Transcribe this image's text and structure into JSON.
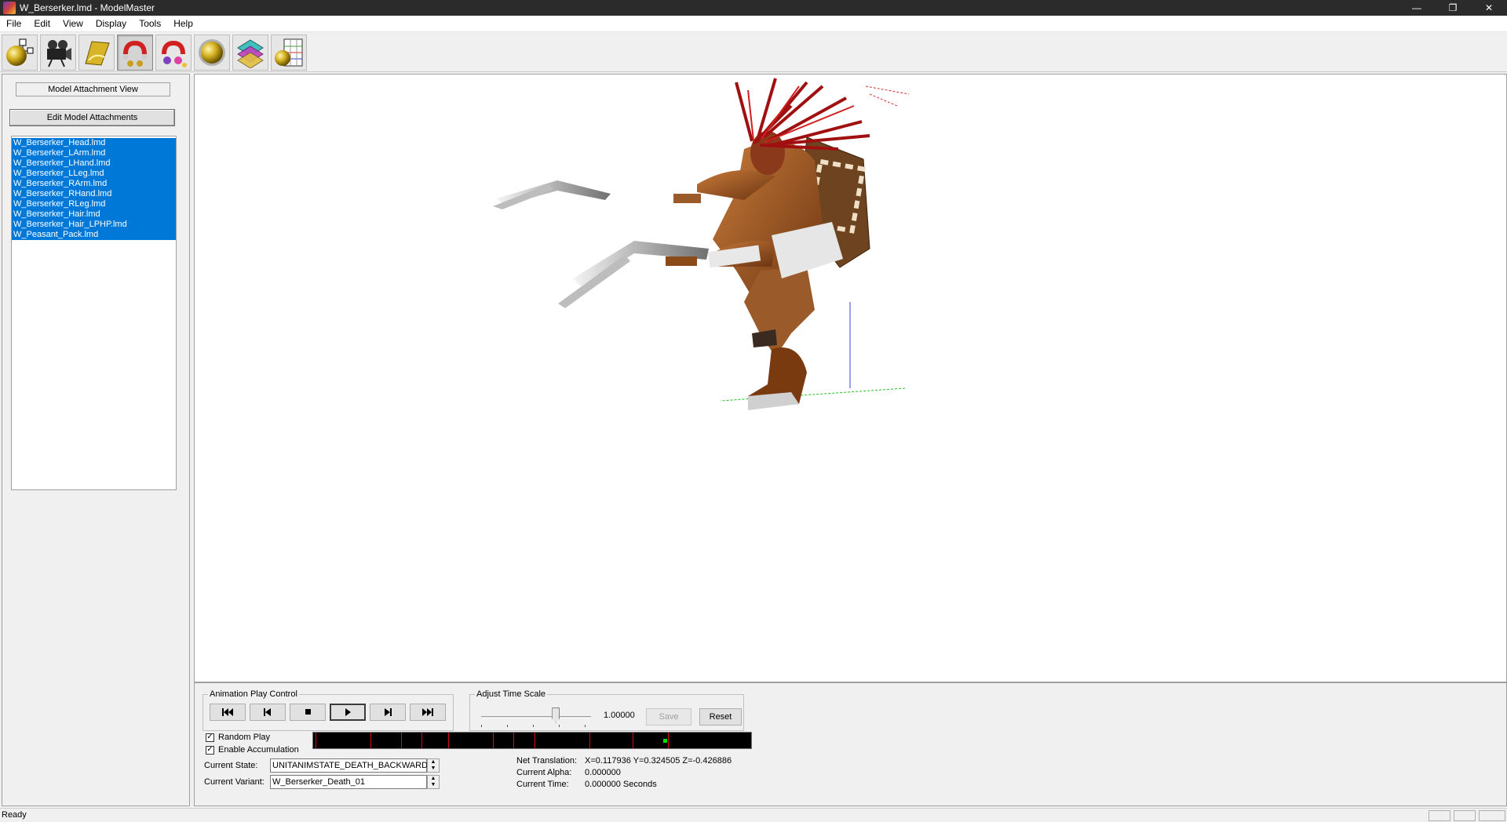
{
  "window": {
    "title": "W_Berserker.lmd - ModelMaster",
    "minimize_glyph": "—",
    "restore_glyph": "❐",
    "close_glyph": "✕"
  },
  "menu": [
    "File",
    "Edit",
    "View",
    "Display",
    "Tools",
    "Help"
  ],
  "toolbar": {
    "tools": [
      {
        "icon": "model-hierarchy-icon",
        "pressed": false
      },
      {
        "icon": "camera-icon",
        "pressed": false
      },
      {
        "icon": "texture-sheet-icon",
        "pressed": false
      },
      {
        "icon": "attach-magnet-icon",
        "pressed": true
      },
      {
        "icon": "particle-magnet-icon",
        "pressed": false
      },
      {
        "icon": "sphere-icon",
        "pressed": false
      },
      {
        "icon": "material-layers-icon",
        "pressed": false
      },
      {
        "icon": "animation-grid-icon",
        "pressed": false
      }
    ]
  },
  "left_panel": {
    "view_label": "Model Attachment View",
    "edit_button": "Edit Model Attachments",
    "attachments": [
      "W_Berserker_Head.lmd",
      "W_Berserker_LArm.lmd",
      "W_Berserker_LHand.lmd",
      "W_Berserker_LLeg.lmd",
      "W_Berserker_RArm.lmd",
      "W_Berserker_RHand.lmd",
      "W_Berserker_RLeg.lmd",
      "W_Berserker_Hair.lmd",
      "W_Berserker_Hair_LPHP.lmd",
      "W_Peasant_Pack.lmd"
    ]
  },
  "animation": {
    "group_label": "Animation Play Control",
    "buttons": [
      "first-frame-icon",
      "previous-frame-icon",
      "stop-icon",
      "play-icon",
      "next-frame-icon",
      "last-frame-icon"
    ],
    "time_scale_label": "Adjust Time Scale",
    "time_scale_value": "1.00000",
    "time_scale_fraction": 0.68,
    "save_label": "Save",
    "reset_label": "Reset",
    "random_play_label": "Random Play",
    "random_play_checked": true,
    "enable_accumulation_label": "Enable Accumulation",
    "enable_accumulation_checked": true,
    "timeline_markers": [
      0.005,
      0.13,
      0.2,
      0.248,
      0.308,
      0.41,
      0.457,
      0.505,
      0.63,
      0.73,
      0.81
    ],
    "timeline_cursor": 0.8,
    "current_state_label": "Current State:",
    "current_state": "UNITANIMSTATE_DEATH_BACKWARD",
    "current_variant_label": "Current Variant:",
    "current_variant": "W_Berserker_Death_01",
    "net_translation_label": "Net Translation:",
    "net_translation": "X=0.117936 Y=0.324505 Z=-0.426886",
    "current_alpha_label": "Current Alpha:",
    "current_alpha": "0.000000",
    "current_time_label": "Current Time:",
    "current_time": "0.000000 Seconds"
  },
  "status": {
    "text": "Ready"
  },
  "colors": {
    "selection": "#0078d7",
    "titlebar": "#2b2b2b",
    "timeline_bg": "#000000",
    "timeline_marker": "#d01010",
    "timeline_cursor": "#00e000"
  }
}
